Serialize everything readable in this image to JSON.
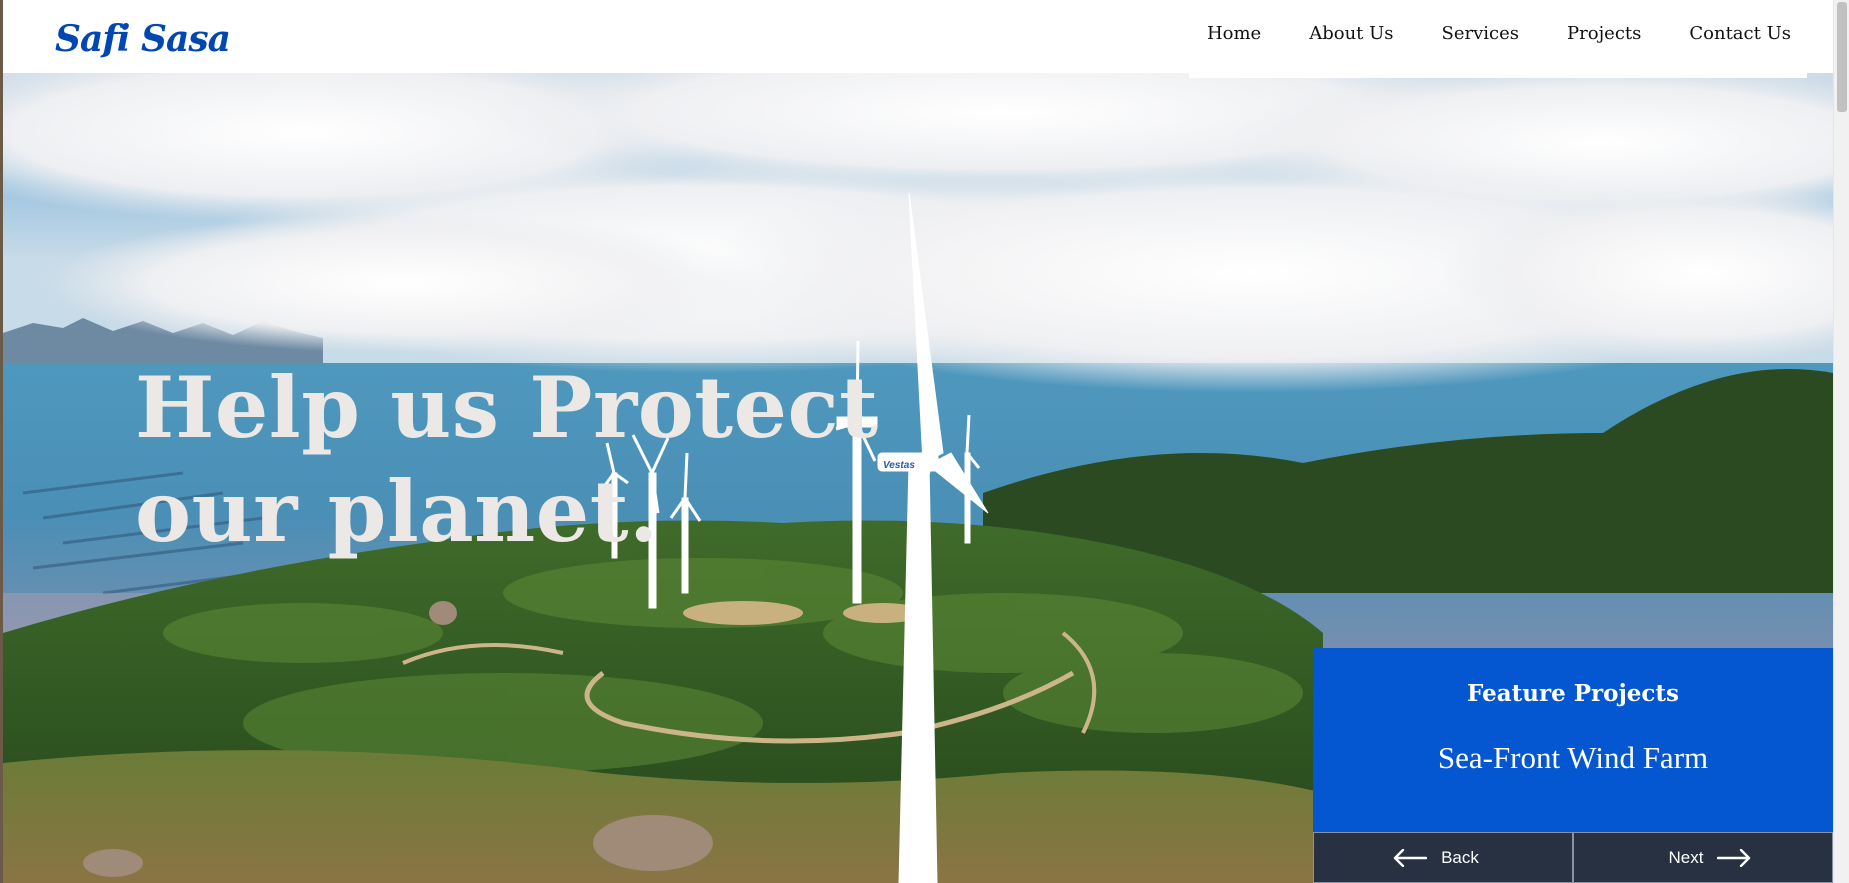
{
  "site": {
    "logo": "Safi Sasa"
  },
  "nav": {
    "items": [
      {
        "label": "Home"
      },
      {
        "label": "About Us"
      },
      {
        "label": "Services"
      },
      {
        "label": "Projects"
      },
      {
        "label": "Contact Us"
      }
    ]
  },
  "hero": {
    "headline_line1": "Help us Protect",
    "headline_line2": "our planet.",
    "turbine_brand": "Vestas"
  },
  "feature": {
    "title": "Feature Projects",
    "project_name": "Sea-Front Wind Farm",
    "back_label": "Back",
    "next_label": "Next"
  },
  "colors": {
    "brand_blue": "#0047b3",
    "card_blue": "#0457d0",
    "card_nav_dark": "#273142",
    "headline_text": "#ece8e6"
  },
  "icons": {
    "back": "arrow-left-icon",
    "next": "arrow-right-icon"
  }
}
